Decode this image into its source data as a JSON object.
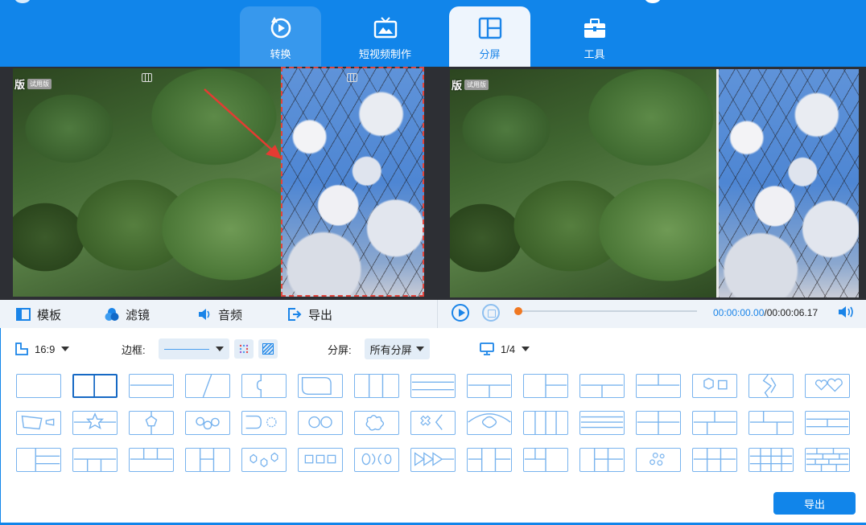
{
  "tabs": [
    {
      "label": "转换",
      "icon": "convert-icon",
      "state": "inactive"
    },
    {
      "label": "短视频制作",
      "icon": "tv-icon",
      "state": "plain"
    },
    {
      "label": "分屏",
      "icon": "split-screen-icon",
      "state": "active"
    },
    {
      "label": "工具",
      "icon": "toolbox-icon",
      "state": "plain"
    }
  ],
  "preview": {
    "watermark_left": "版",
    "watermark_badge": "试用版",
    "watermark_right": "版",
    "watermark_badge_right": "试用版"
  },
  "tools": {
    "template": "模板",
    "filter": "滤镜",
    "audio": "音频",
    "export": "导出"
  },
  "player": {
    "current_time": "00:00:00.00",
    "duration": "/00:00:06.17",
    "progress": 0.0
  },
  "settings": {
    "aspect_ratio": "16:9",
    "border_label": "边框:",
    "split_label": "分屏:",
    "split_value": "所有分屏",
    "screen_value": "1/4"
  },
  "export_button": "导出",
  "colors": {
    "brand": "#1185ea",
    "tab_active_bg": "#eef5fd",
    "template_stroke": "#78b3ee",
    "selected_template": "#1669c4",
    "selection_border": "#e0443c",
    "progress_knob": "#f07822"
  }
}
